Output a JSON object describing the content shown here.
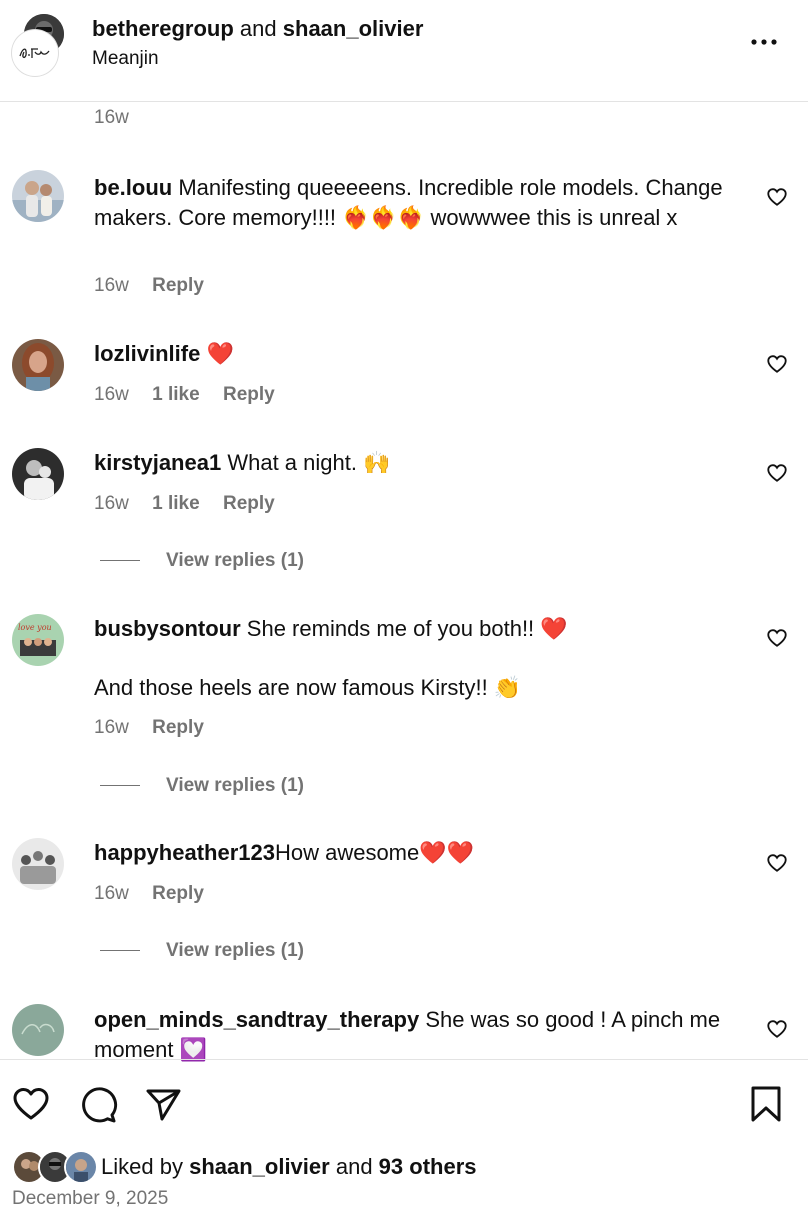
{
  "header": {
    "user1": "betheregroup",
    "and": "and",
    "user2": "shaan_olivier",
    "location": "Meanjin",
    "more_icon": "more-horizontal-icon"
  },
  "top_time": "16w",
  "comments": [
    {
      "username": "be.louu",
      "text": "Manifesting queeeeens. Incredible role models. Change makers. Core memory!!!! ❤️‍🔥❤️‍🔥❤️‍🔥 wowwwee this is unreal x",
      "time": "16w",
      "likes": "",
      "reply": "Reply"
    },
    {
      "username": "lozlivinlife",
      "text": "❤️",
      "time": "16w",
      "likes": "1 like",
      "reply": "Reply"
    },
    {
      "username": "kirstyjanea1",
      "text": "What a night. 🙌",
      "time": "16w",
      "likes": "1 like",
      "reply": "Reply",
      "view_replies": "View replies (1)"
    },
    {
      "username": "busbysontour",
      "text": "She reminds me of you both!! ❤️",
      "text2": "And those heels are now famous Kirsty!! 👏",
      "time": "16w",
      "likes": "",
      "reply": "Reply",
      "view_replies": "View replies (1)"
    },
    {
      "username": "happyheather123",
      "text": "How awesome❤️❤️",
      "time": "16w",
      "likes": "",
      "reply": "Reply",
      "view_replies": "View replies (1)"
    },
    {
      "username": "open_minds_sandtray_therapy",
      "text": "She was so good ! A pinch me moment 💟"
    }
  ],
  "likes_bar": {
    "prefix": "Liked by",
    "user": "shaan_olivier",
    "suffix": "and 93 others"
  },
  "date": "December 9, 2025",
  "colors": {
    "text": "#111111",
    "secondary": "#737373",
    "divider": "#e3e3e3"
  }
}
